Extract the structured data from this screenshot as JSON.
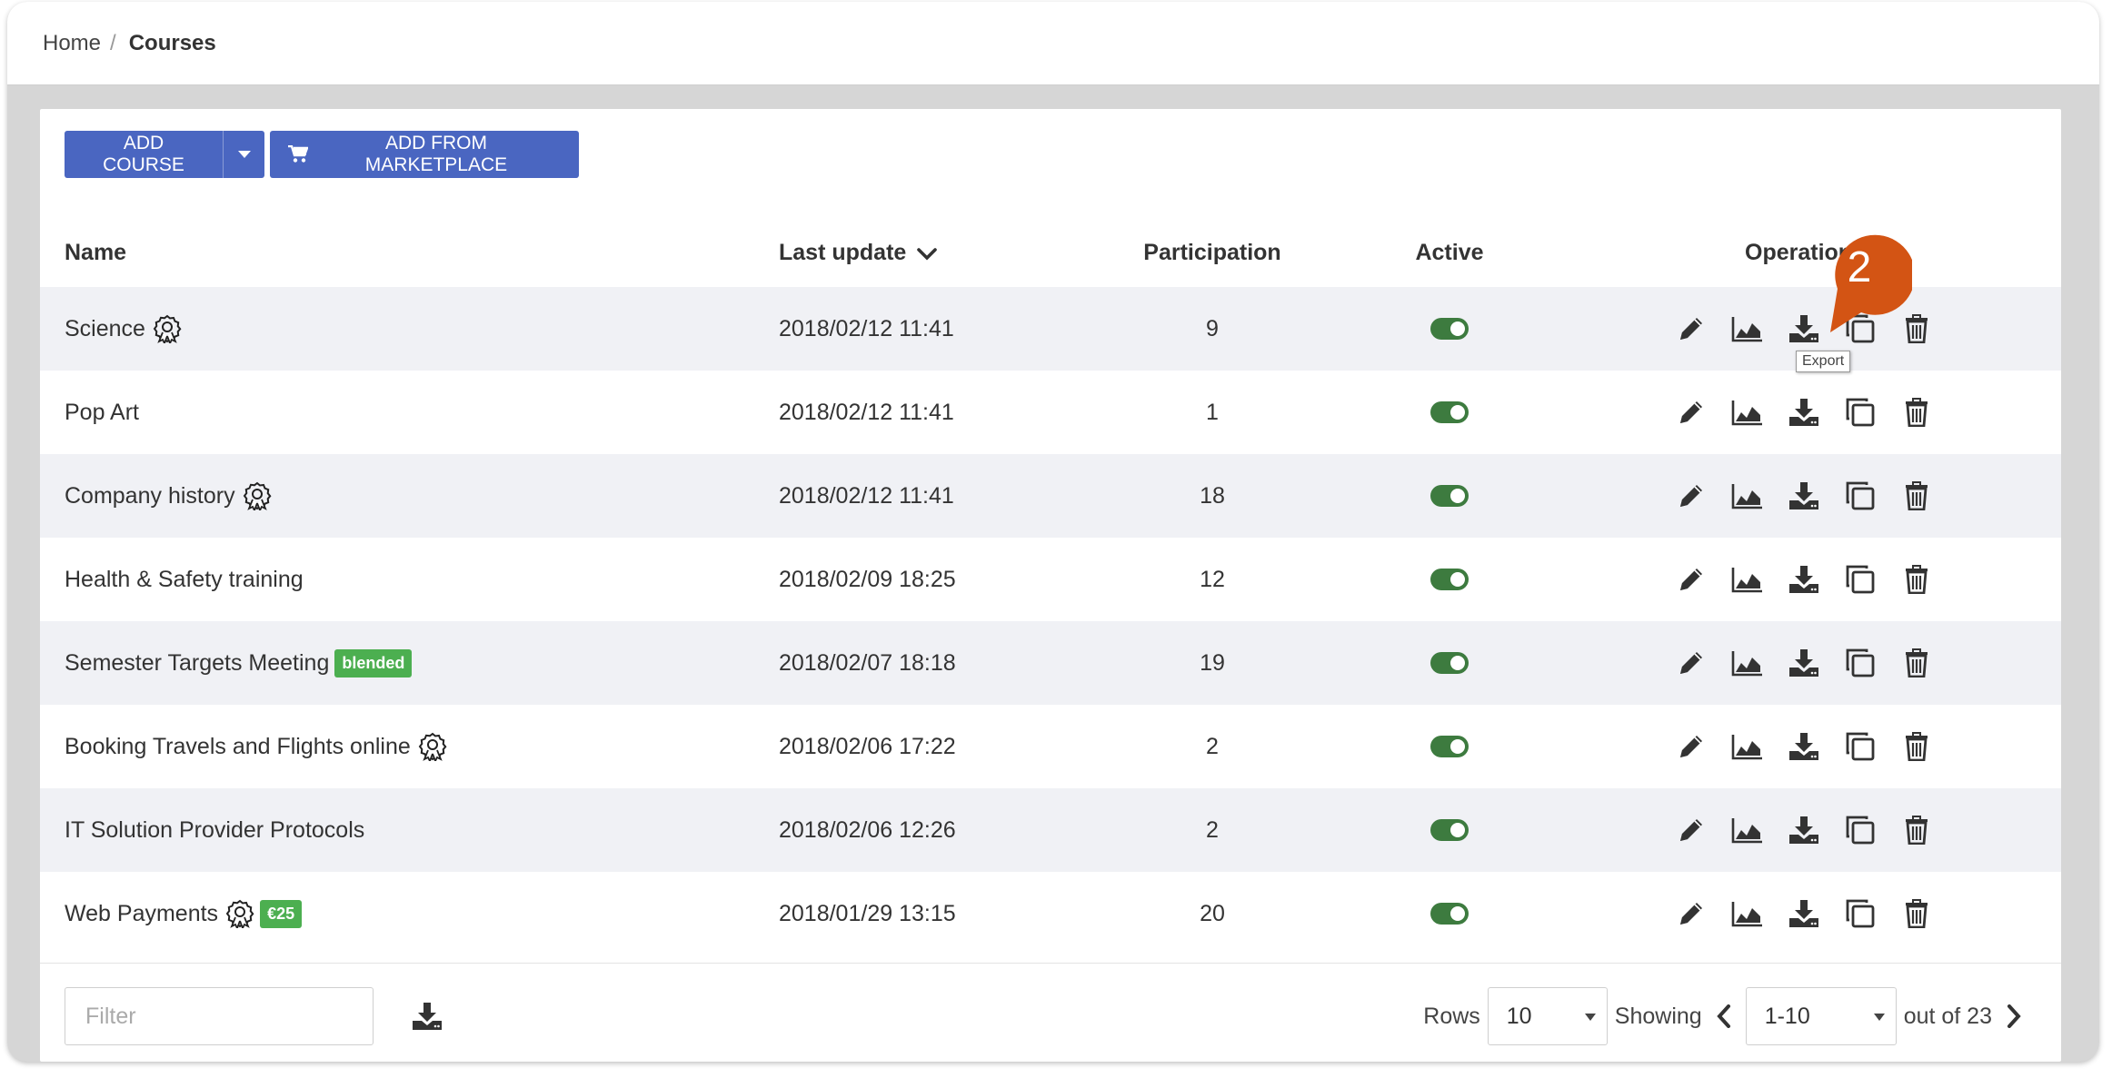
{
  "breadcrumb": {
    "home": "Home",
    "separator": "/",
    "current": "Courses"
  },
  "toolbar": {
    "add_course_label": "ADD COURSE",
    "add_from_marketplace_label": "ADD FROM MARKETPLACE"
  },
  "table": {
    "headers": {
      "name": "Name",
      "last_update": "Last update",
      "participation": "Participation",
      "active": "Active",
      "operations": "Operations"
    },
    "rows": [
      {
        "name": "Science",
        "certificate": true,
        "badge": "",
        "last_update": "2018/02/12 11:41",
        "participation": "9",
        "active": true
      },
      {
        "name": "Pop Art",
        "certificate": false,
        "badge": "",
        "last_update": "2018/02/12 11:41",
        "participation": "1",
        "active": true
      },
      {
        "name": "Company history",
        "certificate": true,
        "badge": "",
        "last_update": "2018/02/12 11:41",
        "participation": "18",
        "active": true
      },
      {
        "name": "Health & Safety training",
        "certificate": false,
        "badge": "",
        "last_update": "2018/02/09 18:25",
        "participation": "12",
        "active": true
      },
      {
        "name": "Semester Targets Meeting",
        "certificate": false,
        "badge": "blended",
        "last_update": "2018/02/07 18:18",
        "participation": "19",
        "active": true
      },
      {
        "name": "Booking Travels and Flights online",
        "certificate": true,
        "badge": "",
        "last_update": "2018/02/06 17:22",
        "participation": "2",
        "active": true
      },
      {
        "name": "IT Solution Provider Protocols",
        "certificate": false,
        "badge": "",
        "last_update": "2018/02/06 12:26",
        "participation": "2",
        "active": true
      },
      {
        "name": "Web Payments",
        "certificate": true,
        "badge": "€25",
        "last_update": "2018/01/29 13:15",
        "participation": "20",
        "active": true
      }
    ]
  },
  "tooltip": {
    "export": "Export"
  },
  "callout": {
    "number": "2",
    "color": "#d35414"
  },
  "footer": {
    "filter_placeholder": "Filter",
    "rows_label": "Rows",
    "rows_value": "10",
    "showing_label": "Showing",
    "range_value": "1-10",
    "out_of_label": "out of 23"
  },
  "colors": {
    "primary": "#4a66c1",
    "toggle_on": "#3d7b3f",
    "badge": "#4caf50",
    "row_shade": "#f0f1f5"
  },
  "icons": {
    "row_operations": [
      "pencil-icon",
      "area-chart-icon",
      "download-icon",
      "copy-icon",
      "trash-icon"
    ],
    "certificate": "award-ribbon-icon"
  }
}
